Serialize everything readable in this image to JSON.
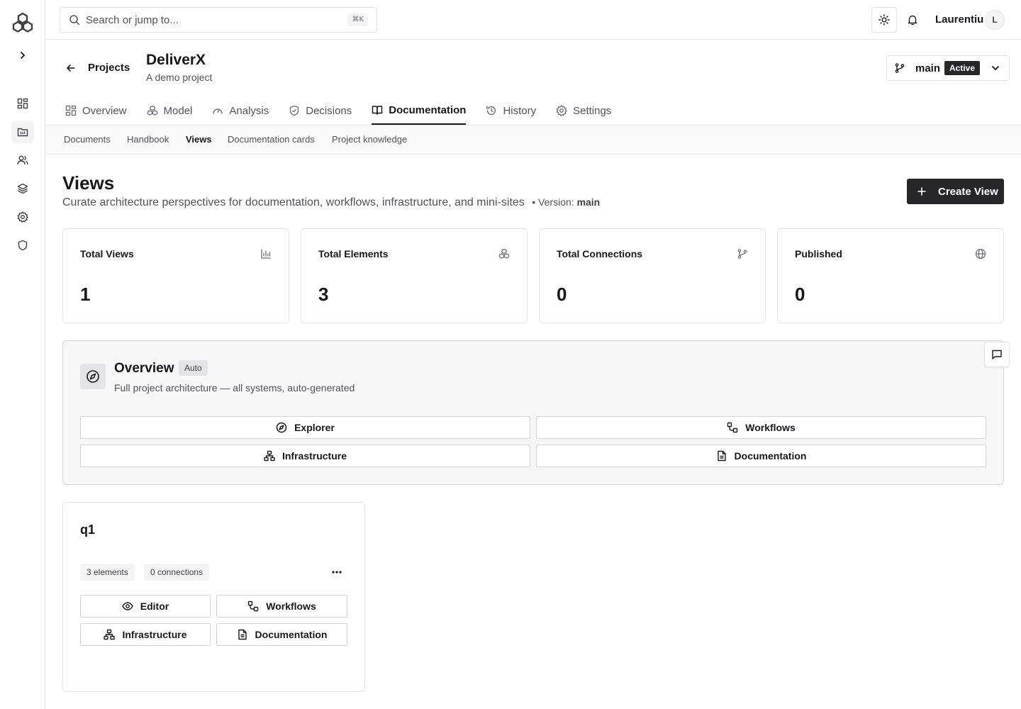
{
  "topbar": {
    "search_placeholder": "Search or jump to...",
    "shortcut": "⌘K",
    "user_name": "Laurentiu",
    "avatar_initial": "L"
  },
  "header": {
    "back_label": "Projects",
    "project_title": "DeliverX",
    "project_subtitle": "A demo project",
    "branch_name": "main",
    "branch_status": "Active"
  },
  "tabs": [
    {
      "label": "Overview",
      "icon": "dashboard-icon"
    },
    {
      "label": "Model",
      "icon": "boxes-icon"
    },
    {
      "label": "Analysis",
      "icon": "gauge-icon"
    },
    {
      "label": "Decisions",
      "icon": "shield-check-icon"
    },
    {
      "label": "Documentation",
      "icon": "book-open-icon"
    },
    {
      "label": "History",
      "icon": "history-icon"
    },
    {
      "label": "Settings",
      "icon": "gear-icon"
    }
  ],
  "subtabs": [
    "Documents",
    "Handbook",
    "Views",
    "Documentation cards",
    "Project knowledge"
  ],
  "page": {
    "title": "Views",
    "description": "Curate architecture perspectives for documentation, workflows, infrastructure, and mini-sites",
    "version_label": "• Version:",
    "version_value": "main",
    "create_label": "Create View"
  },
  "stats": [
    {
      "label": "Total Views",
      "value": "1",
      "icon": "bar-chart-icon"
    },
    {
      "label": "Total Elements",
      "value": "3",
      "icon": "boxes-icon"
    },
    {
      "label": "Total Connections",
      "value": "0",
      "icon": "git-branch-icon"
    },
    {
      "label": "Published",
      "value": "0",
      "icon": "globe-icon"
    }
  ],
  "overview_card": {
    "title": "Overview",
    "badge": "Auto",
    "description": "Full project architecture — all systems, auto-generated",
    "buttons": [
      "Explorer",
      "Workflows",
      "Infrastructure",
      "Documentation"
    ]
  },
  "view_card": {
    "title": "q1",
    "elements": "3 elements",
    "connections": "0 connections",
    "buttons": [
      "Editor",
      "Workflows",
      "Infrastructure",
      "Documentation"
    ]
  },
  "colors": {
    "primary_button": "#27272a",
    "border": "#e4e4e7",
    "muted_text": "#52525b"
  }
}
